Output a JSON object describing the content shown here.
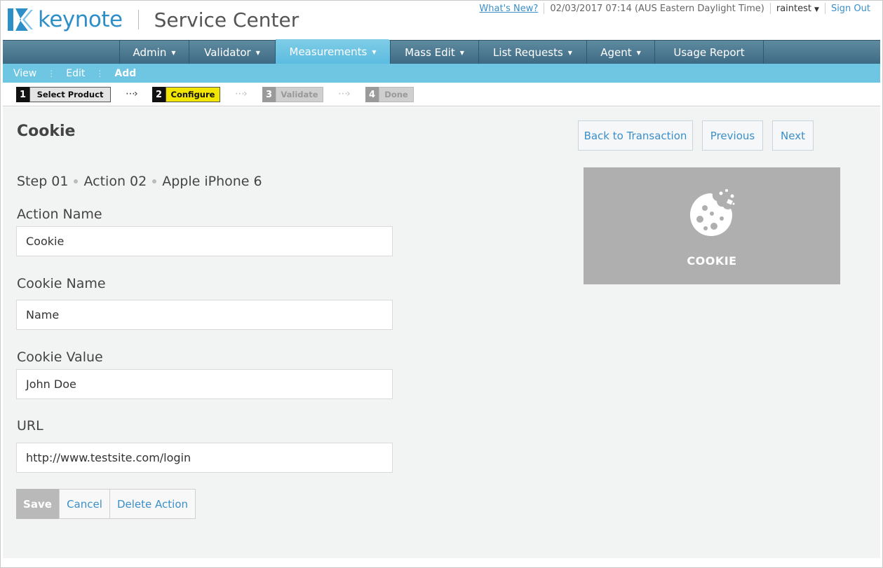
{
  "header": {
    "brand": "keynote",
    "product": "Service Center",
    "whats_new": "What's New?",
    "datetime": "02/03/2017 07:14 (AUS Eastern Daylight Time)",
    "user": "raintest",
    "sign_out": "Sign Out"
  },
  "main_nav": [
    {
      "label": "Admin"
    },
    {
      "label": "Validator"
    },
    {
      "label": "Measurements"
    },
    {
      "label": "Mass Edit"
    },
    {
      "label": "List Requests"
    },
    {
      "label": "Agent"
    },
    {
      "label": "Usage Report"
    }
  ],
  "active_nav": "Measurements",
  "sub_nav": [
    {
      "label": "View"
    },
    {
      "label": "Edit"
    },
    {
      "label": "Add"
    }
  ],
  "wizard": [
    {
      "num": "1",
      "label": "Select Product",
      "state": "done"
    },
    {
      "num": "2",
      "label": "Configure",
      "state": "current"
    },
    {
      "num": "3",
      "label": "Validate",
      "state": "pending"
    },
    {
      "num": "4",
      "label": "Done",
      "state": "pending"
    }
  ],
  "page": {
    "title": "Cookie",
    "back_button": "Back to Transaction",
    "previous_button": "Previous",
    "next_button": "Next",
    "breadcrumb": [
      "Step 01",
      "Action 02",
      "Apple iPhone 6"
    ]
  },
  "form": {
    "action_name_label": "Action Name",
    "action_name_value": "Cookie",
    "cookie_name_label": "Cookie Name",
    "cookie_name_value": "Name",
    "cookie_value_label": "Cookie Value",
    "cookie_value_value": "John Doe",
    "url_label": "URL",
    "url_value": "http://www.testsite.com/login"
  },
  "buttons": {
    "save": "Save",
    "cancel": "Cancel",
    "delete": "Delete Action"
  },
  "preview": {
    "label": "COOKIE",
    "icon": "cookie-icon"
  },
  "colors": {
    "accent_blue": "#3a8fc8",
    "nav_dark": "#4a778f",
    "nav_active": "#6ec6e2",
    "configure_yellow": "#f2e600"
  }
}
